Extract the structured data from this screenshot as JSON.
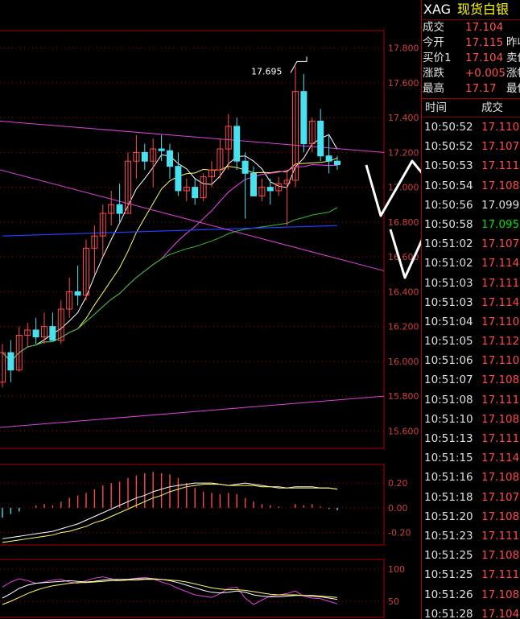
{
  "colors": {
    "up": "#ff4a4a",
    "down": "#49e0f0",
    "background": "#000000",
    "grid": "#b00000",
    "axis_text": "#d04040"
  },
  "quote": {
    "code": "XAG",
    "name": "现货白银",
    "rows": [
      {
        "label": "成交",
        "value": "17.104",
        "label2": ""
      },
      {
        "label": "今开",
        "value": "17.115",
        "label2": "昨收"
      },
      {
        "label": "买价1",
        "value": "17.104",
        "label2": "卖价"
      },
      {
        "label": "涨跌",
        "value": "+0.005",
        "label2": "涨幅"
      },
      {
        "label": "最高",
        "value": "17.17",
        "label2": "最低"
      }
    ]
  },
  "ticks": {
    "col_time": "时间",
    "col_price": "成交",
    "rows": [
      {
        "time": "10:50:52",
        "price": "17.110",
        "dir": "up"
      },
      {
        "time": "10:50:52",
        "price": "17.107",
        "dir": "up"
      },
      {
        "time": "10:50:53",
        "price": "17.111",
        "dir": "up"
      },
      {
        "time": "10:50:54",
        "price": "17.108",
        "dir": "up"
      },
      {
        "time": "10:50:56",
        "price": "17.099",
        "dir": "flat"
      },
      {
        "time": "10:50:58",
        "price": "17.095",
        "dir": "down"
      },
      {
        "time": "10:51:02",
        "price": "17.107",
        "dir": "up"
      },
      {
        "time": "10:51:02",
        "price": "17.114",
        "dir": "up"
      },
      {
        "time": "10:51:03",
        "price": "17.111",
        "dir": "up"
      },
      {
        "time": "10:51:03",
        "price": "17.114",
        "dir": "up"
      },
      {
        "time": "10:51:04",
        "price": "17.110",
        "dir": "up"
      },
      {
        "time": "10:51:05",
        "price": "17.112",
        "dir": "up"
      },
      {
        "time": "10:51:06",
        "price": "17.110",
        "dir": "up"
      },
      {
        "time": "10:51:07",
        "price": "17.108",
        "dir": "up"
      },
      {
        "time": "10:51:08",
        "price": "17.111",
        "dir": "up"
      },
      {
        "time": "10:51:10",
        "price": "17.108",
        "dir": "up"
      },
      {
        "time": "10:51:13",
        "price": "17.111",
        "dir": "up"
      },
      {
        "time": "10:51:15",
        "price": "17.114",
        "dir": "up"
      },
      {
        "time": "10:51:16",
        "price": "17.108",
        "dir": "up"
      },
      {
        "time": "10:51:18",
        "price": "17.107",
        "dir": "up"
      },
      {
        "time": "10:51:20",
        "price": "17.108",
        "dir": "up"
      },
      {
        "time": "10:51:23",
        "price": "17.111",
        "dir": "up"
      },
      {
        "time": "10:51:25",
        "price": "17.108",
        "dir": "up"
      },
      {
        "time": "10:51:25",
        "price": "17.111",
        "dir": "up"
      },
      {
        "time": "10:51:26",
        "price": "17.108",
        "dir": "up"
      },
      {
        "time": "10:51:28",
        "price": "17.104",
        "dir": "up"
      }
    ]
  },
  "chart_data": [
    {
      "type": "candlestick",
      "ylim": [
        15.5,
        17.9
      ],
      "yticks": [
        "17.800",
        "17.600",
        "17.400",
        "17.200",
        "17.000",
        "16.800",
        "16.600",
        "16.400",
        "16.200",
        "16.000",
        "15.800",
        "15.600"
      ],
      "ytick_values": [
        17.8,
        17.6,
        17.4,
        17.2,
        17.0,
        16.8,
        16.6,
        16.4,
        16.2,
        16.0,
        15.8,
        15.6
      ],
      "annotation": {
        "text": "17.695",
        "value": 17.695,
        "index": 35
      },
      "candles": [
        {
          "o": 15.88,
          "h": 16.1,
          "l": 15.85,
          "c": 16.05
        },
        {
          "o": 16.05,
          "h": 16.12,
          "l": 15.88,
          "c": 15.95
        },
        {
          "o": 15.95,
          "h": 16.2,
          "l": 15.94,
          "c": 16.15
        },
        {
          "o": 16.15,
          "h": 16.22,
          "l": 16.08,
          "c": 16.18
        },
        {
          "o": 16.18,
          "h": 16.25,
          "l": 16.1,
          "c": 16.14
        },
        {
          "o": 16.14,
          "h": 16.28,
          "l": 16.1,
          "c": 16.2
        },
        {
          "o": 16.2,
          "h": 16.28,
          "l": 16.12,
          "c": 16.12
        },
        {
          "o": 16.12,
          "h": 16.35,
          "l": 16.1,
          "c": 16.3
        },
        {
          "o": 16.3,
          "h": 16.48,
          "l": 16.25,
          "c": 16.4
        },
        {
          "o": 16.4,
          "h": 16.55,
          "l": 16.32,
          "c": 16.38
        },
        {
          "o": 16.38,
          "h": 16.7,
          "l": 16.35,
          "c": 16.65
        },
        {
          "o": 16.65,
          "h": 16.78,
          "l": 16.5,
          "c": 16.72
        },
        {
          "o": 16.72,
          "h": 16.9,
          "l": 16.6,
          "c": 16.85
        },
        {
          "o": 16.85,
          "h": 16.98,
          "l": 16.78,
          "c": 16.9
        },
        {
          "o": 16.9,
          "h": 17.02,
          "l": 16.8,
          "c": 16.85
        },
        {
          "o": 16.85,
          "h": 17.2,
          "l": 16.85,
          "c": 17.15
        },
        {
          "o": 17.15,
          "h": 17.3,
          "l": 17.05,
          "c": 17.2
        },
        {
          "o": 17.2,
          "h": 17.25,
          "l": 17.1,
          "c": 17.15
        },
        {
          "o": 17.15,
          "h": 17.28,
          "l": 17.0,
          "c": 17.22
        },
        {
          "o": 17.22,
          "h": 17.3,
          "l": 17.15,
          "c": 17.21
        },
        {
          "o": 17.21,
          "h": 17.25,
          "l": 17.05,
          "c": 17.12
        },
        {
          "o": 17.12,
          "h": 17.2,
          "l": 16.95,
          "c": 16.98
        },
        {
          "o": 16.98,
          "h": 17.05,
          "l": 16.92,
          "c": 17.0
        },
        {
          "o": 17.0,
          "h": 17.05,
          "l": 16.9,
          "c": 16.94
        },
        {
          "o": 16.94,
          "h": 17.08,
          "l": 16.92,
          "c": 17.06
        },
        {
          "o": 17.06,
          "h": 17.15,
          "l": 17.0,
          "c": 17.1
        },
        {
          "o": 17.1,
          "h": 17.28,
          "l": 17.05,
          "c": 17.22
        },
        {
          "o": 17.22,
          "h": 17.42,
          "l": 17.1,
          "c": 17.35
        },
        {
          "o": 17.35,
          "h": 17.4,
          "l": 17.1,
          "c": 17.15
        },
        {
          "o": 17.15,
          "h": 17.2,
          "l": 16.82,
          "c": 17.08
        },
        {
          "o": 17.08,
          "h": 17.12,
          "l": 16.95,
          "c": 16.95
        },
        {
          "o": 16.95,
          "h": 17.05,
          "l": 16.92,
          "c": 17.0
        },
        {
          "o": 17.0,
          "h": 17.05,
          "l": 16.9,
          "c": 16.98
        },
        {
          "o": 16.98,
          "h": 17.06,
          "l": 16.95,
          "c": 17.02
        },
        {
          "o": 17.02,
          "h": 17.1,
          "l": 16.78,
          "c": 17.04
        },
        {
          "o": 17.04,
          "h": 17.695,
          "l": 17.0,
          "c": 17.55
        },
        {
          "o": 17.55,
          "h": 17.65,
          "l": 17.2,
          "c": 17.25
        },
        {
          "o": 17.25,
          "h": 17.4,
          "l": 17.2,
          "c": 17.38
        },
        {
          "o": 17.38,
          "h": 17.45,
          "l": 17.15,
          "c": 17.18
        },
        {
          "o": 17.18,
          "h": 17.3,
          "l": 17.08,
          "c": 17.15
        },
        {
          "o": 17.15,
          "h": 17.18,
          "l": 17.1,
          "c": 17.13
        }
      ]
    },
    {
      "type": "bar",
      "ylim": [
        -0.3,
        0.35
      ],
      "yticks": [
        "0.20",
        "0.00",
        "-0.20"
      ],
      "ytick_values": [
        0.2,
        0.0,
        -0.2
      ],
      "values": [
        -0.08,
        -0.05,
        -0.03,
        0.0,
        0.02,
        0.03,
        0.02,
        0.05,
        0.08,
        0.1,
        0.12,
        0.15,
        0.18,
        0.2,
        0.21,
        0.24,
        0.26,
        0.28,
        0.29,
        0.28,
        0.27,
        0.24,
        0.2,
        0.16,
        0.13,
        0.12,
        0.11,
        0.12,
        0.11,
        0.08,
        0.05,
        0.03,
        0.02,
        0.01,
        0.0,
        0.03,
        0.02,
        0.03,
        0.01,
        -0.01,
        -0.02
      ],
      "series": [
        {
          "values": [
            -0.25,
            -0.24,
            -0.23,
            -0.22,
            -0.21,
            -0.2,
            -0.19,
            -0.17,
            -0.15,
            -0.13,
            -0.1,
            -0.07,
            -0.04,
            -0.01,
            0.02,
            0.05,
            0.08,
            0.1,
            0.13,
            0.15,
            0.17,
            0.18,
            0.19,
            0.2,
            0.2,
            0.2,
            0.19,
            0.18,
            0.19,
            0.2,
            0.19,
            0.18,
            0.17,
            0.17,
            0.16,
            0.17,
            0.17,
            0.17,
            0.16,
            0.16,
            0.15
          ]
        },
        {
          "values": [
            -0.28,
            -0.27,
            -0.26,
            -0.25,
            -0.24,
            -0.23,
            -0.22,
            -0.2,
            -0.19,
            -0.17,
            -0.15,
            -0.12,
            -0.1,
            -0.07,
            -0.04,
            -0.01,
            0.02,
            0.05,
            0.08,
            0.1,
            0.13,
            0.15,
            0.17,
            0.18,
            0.19,
            0.19,
            0.19,
            0.18,
            0.18,
            0.18,
            0.18,
            0.17,
            0.17,
            0.16,
            0.16,
            0.16,
            0.16,
            0.16,
            0.16,
            0.16,
            0.15
          ]
        }
      ]
    },
    {
      "type": "line",
      "ylim": [
        25,
        115
      ],
      "yticks": [
        "100",
        "50"
      ],
      "ytick_values": [
        100,
        50
      ],
      "series": [
        {
          "values": [
            72,
            80,
            85,
            82,
            78,
            80,
            83,
            84,
            80,
            78,
            82,
            86,
            88,
            85,
            82,
            84,
            86,
            87,
            85,
            80,
            76,
            70,
            65,
            60,
            58,
            56,
            62,
            70,
            72,
            55,
            45,
            52,
            58,
            60,
            62,
            66,
            58,
            55,
            54,
            50,
            46
          ]
        },
        {
          "values": [
            55,
            62,
            70,
            75,
            78,
            79,
            80,
            81,
            82,
            81,
            80,
            81,
            83,
            84,
            84,
            84,
            85,
            85,
            85,
            84,
            82,
            79,
            75,
            71,
            67,
            64,
            63,
            64,
            66,
            64,
            60,
            58,
            57,
            57,
            58,
            59,
            59,
            58,
            57,
            55,
            53
          ]
        },
        {
          "values": [
            45,
            50,
            56,
            62,
            67,
            71,
            74,
            76,
            78,
            79,
            79,
            80,
            81,
            82,
            82,
            83,
            83,
            84,
            84,
            84,
            83,
            82,
            80,
            77,
            74,
            71,
            69,
            68,
            68,
            67,
            65,
            63,
            61,
            60,
            60,
            60,
            59,
            59,
            58,
            57,
            56
          ]
        }
      ]
    }
  ]
}
